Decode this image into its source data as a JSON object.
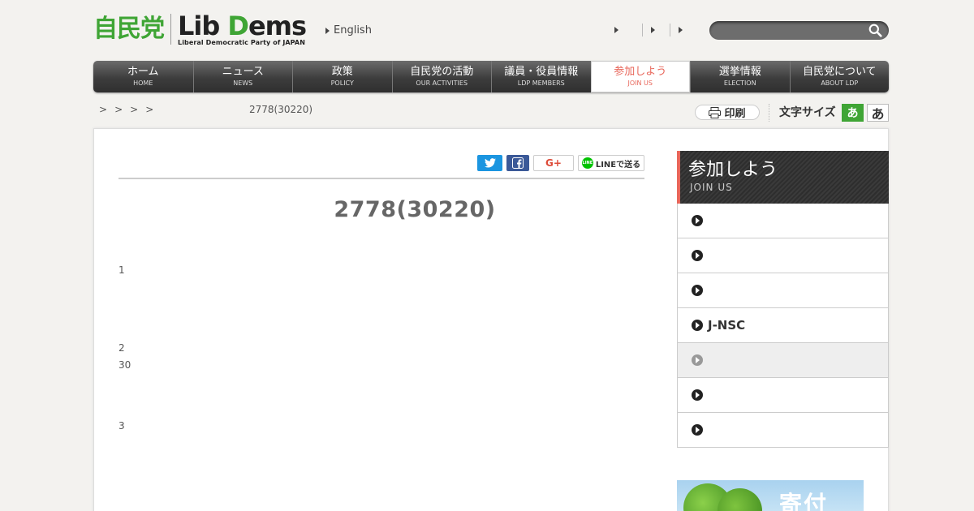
{
  "header": {
    "logo_jp": "自民党",
    "logo_en_lib": "Lib ",
    "logo_en_d": "D",
    "logo_en_ems": "ems",
    "logo_en_sub": "Liberal Democratic Party of JAPAN",
    "lang_link": "English",
    "search_placeholder": ""
  },
  "nav": [
    {
      "jp": "ホーム",
      "en": "HOME"
    },
    {
      "jp": "ニュース",
      "en": "NEWS"
    },
    {
      "jp": "政策",
      "en": "POLICY"
    },
    {
      "jp": "自民党の活動",
      "en": "OUR ACTIVITIES"
    },
    {
      "jp": "議員・役員情報",
      "en": "LDP MEMBERS"
    },
    {
      "jp": "参加しよう",
      "en": "JOIN US"
    },
    {
      "jp": "選挙情報",
      "en": "ELECTION"
    },
    {
      "jp": "自民党について",
      "en": "ABOUT LDP"
    }
  ],
  "breadcrumb": [
    ">",
    ">",
    ">",
    ">"
  ],
  "breadcrumb_current": "2778(30220)",
  "print_label": "印刷",
  "font_size_label": "文字サイズ",
  "font_small": "あ",
  "font_large": "あ",
  "share": {
    "gplus": "G+",
    "line": "LINEで送る"
  },
  "article": {
    "title": "2778(30220)",
    "paragraphs": [
      "1",
      "2",
      "30",
      "3"
    ]
  },
  "sidebar": {
    "title_jp": "参加しよう",
    "title_en": "JOIN US",
    "items": [
      "",
      "",
      "",
      "J-NSC",
      "",
      "",
      ""
    ]
  },
  "banner_text": "寄付",
  "colors": {
    "brand_green": "#3fa535",
    "accent_red": "#e8665a"
  }
}
